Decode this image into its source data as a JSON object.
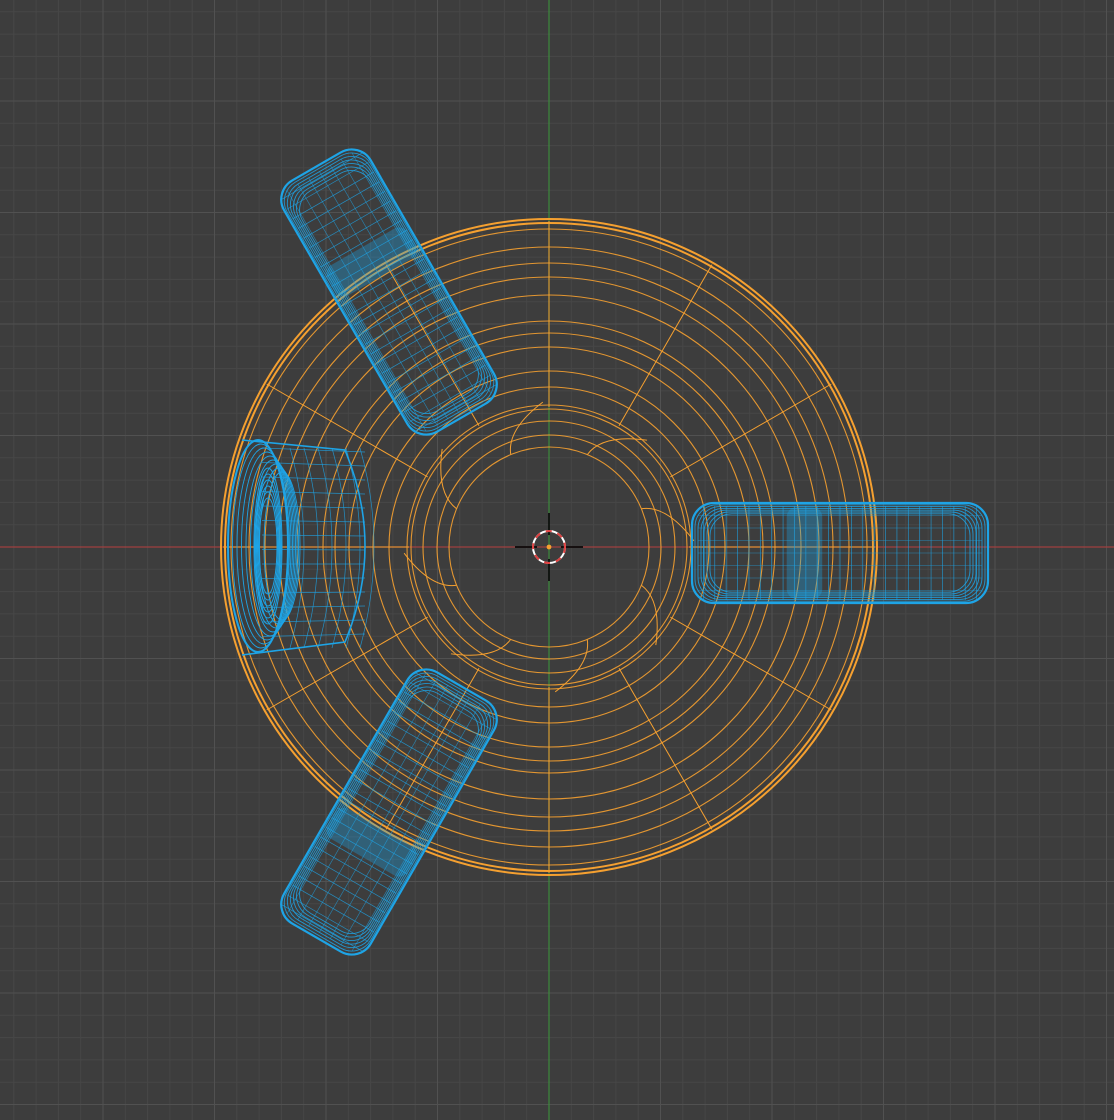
{
  "viewport": {
    "view": "top-orthographic",
    "shading": "wireframe",
    "background_color": "#3d3d3d",
    "grid": {
      "minor_color": "#474747",
      "major_color": "#515151"
    },
    "axes": {
      "x_axis_color": "#a04040",
      "y_axis_color": "#3d8a3d"
    }
  },
  "scene": {
    "active_object": {
      "name_semantic": "base-disc",
      "selection_state": "selected-active",
      "color": "#f5a030"
    },
    "other_objects": {
      "count": 4,
      "name_semantic": "tire-objects",
      "color": "#1ea4e6"
    },
    "cursor": {
      "name_semantic": "3d-cursor",
      "ring_colors": [
        "#e04040",
        "#ffffff"
      ]
    }
  }
}
